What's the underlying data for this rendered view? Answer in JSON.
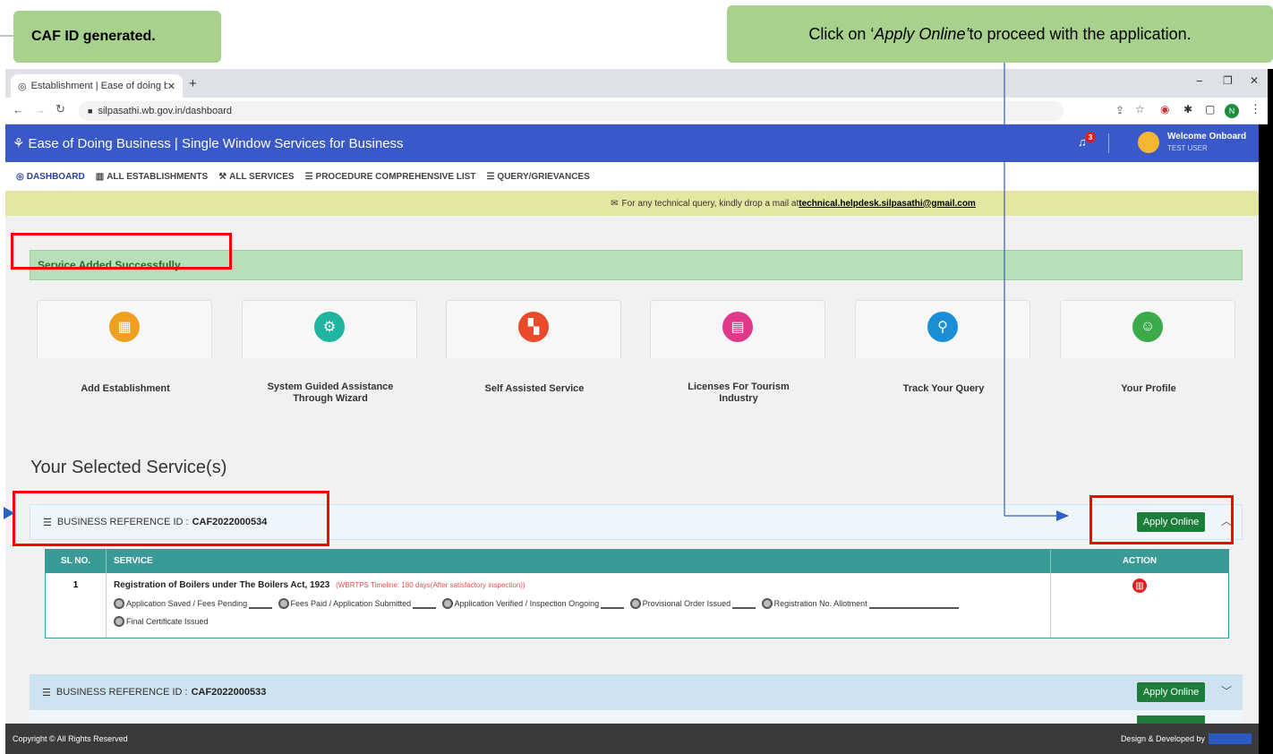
{
  "callouts": {
    "left": "CAF ID generated.",
    "right_pre": "Click on ‘",
    "right_em": "Apply Online’",
    "right_post": " to proceed with the application."
  },
  "browser": {
    "tab_title": "Establishment | Ease of doing bu",
    "url": "silpasathi.wb.gov.in/dashboard"
  },
  "header": {
    "title": "Ease of Doing Business | Single Window Services for Business",
    "notif_count": "3",
    "welcome": "Welcome Onboard",
    "user": "TEST USER"
  },
  "nav": [
    "DASHBOARD",
    "ALL ESTABLISHMENTS",
    "ALL SERVICES",
    "PROCEDURE COMPREHENSIVE LIST",
    "QUERY/GRIEVANCES"
  ],
  "notice": {
    "text": "For any technical query, kindly drop a mail at ",
    "email": "technical.helpdesk.silpasathi@gmail.com"
  },
  "alert": "Service Added Successfully",
  "cards": [
    {
      "label": "Add Establishment",
      "color": "#f0a020",
      "icon": "building-icon"
    },
    {
      "label": "System Guided Assistance Through Wizard",
      "color": "#1fb5a0",
      "icon": "gear-icon"
    },
    {
      "label": "Self Assisted Service",
      "color": "#e84a2a",
      "icon": "grid-icon"
    },
    {
      "label": "Licenses For Tourism Industry",
      "color": "#e0388a",
      "icon": "license-icon"
    },
    {
      "label": "Track Your Query",
      "color": "#1a8fd8",
      "icon": "search-icon"
    },
    {
      "label": "Your Profile",
      "color": "#3aaa4a",
      "icon": "profile-icon"
    }
  ],
  "section_title": "Your Selected Service(s)",
  "ref1": {
    "label": "BUSINESS REFERENCE ID :",
    "id": "CAF2022000534",
    "button": "Apply Online"
  },
  "table": {
    "headers": [
      "SL NO.",
      "SERVICE",
      "ACTION"
    ],
    "row": {
      "sl": "1",
      "service": "Registration of Boilers under The Boilers Act, 1923",
      "timeline": "(WBRTPS Timeline: 180 days(After satisfactory inspection))",
      "steps": [
        "Application Saved / Fees Pending",
        "Fees Paid / Application Submitted",
        "Application Verified / Inspection Ongoing",
        "Provisional Order Issued",
        "Registration No. Allotment",
        "Final Certificate Issued"
      ]
    }
  },
  "ref2": {
    "label": "BUSINESS REFERENCE ID :",
    "id": "CAF2022000533",
    "button": "Apply Online"
  },
  "footer": {
    "left": "Copyright © All Rights Reserved",
    "right": "Design & Developed by"
  }
}
